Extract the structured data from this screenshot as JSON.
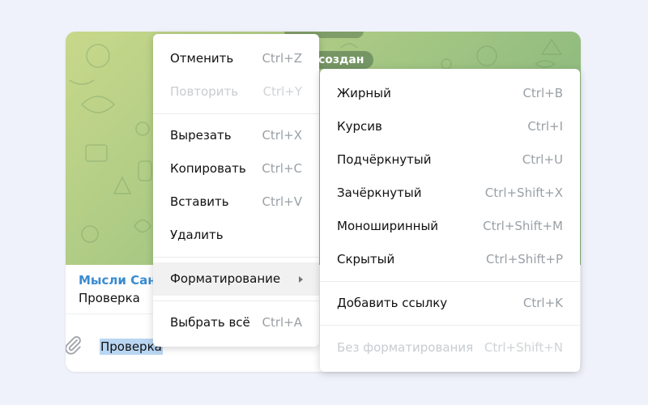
{
  "chat": {
    "date_pill": "создан",
    "reply": {
      "name": "Мысли Сан",
      "text": "Проверка"
    },
    "input": {
      "value": "Проверка"
    }
  },
  "context_menu": {
    "items": [
      {
        "label": "Отменить",
        "shortcut": "Ctrl+Z",
        "disabled": false
      },
      {
        "label": "Повторить",
        "shortcut": "Ctrl+Y",
        "disabled": true
      },
      {
        "label": "Вырезать",
        "shortcut": "Ctrl+X",
        "disabled": false
      },
      {
        "label": "Копировать",
        "shortcut": "Ctrl+C",
        "disabled": false
      },
      {
        "label": "Вставить",
        "shortcut": "Ctrl+V",
        "disabled": false
      },
      {
        "label": "Удалить",
        "shortcut": "",
        "disabled": false
      },
      {
        "label": "Форматирование",
        "shortcut": "",
        "disabled": false,
        "has_submenu": true,
        "active": true
      },
      {
        "label": "Выбрать всё",
        "shortcut": "Ctrl+A",
        "disabled": false
      }
    ]
  },
  "format_submenu": {
    "items": [
      {
        "label": "Жирный",
        "shortcut": "Ctrl+B",
        "disabled": false
      },
      {
        "label": "Курсив",
        "shortcut": "Ctrl+I",
        "disabled": false
      },
      {
        "label": "Подчёркнутый",
        "shortcut": "Ctrl+U",
        "disabled": false
      },
      {
        "label": "Зачёркнутый",
        "shortcut": "Ctrl+Shift+X",
        "disabled": false
      },
      {
        "label": "Моноширинный",
        "shortcut": "Ctrl+Shift+M",
        "disabled": false
      },
      {
        "label": "Скрытый",
        "shortcut": "Ctrl+Shift+P",
        "disabled": false
      },
      {
        "label": "Добавить ссылку",
        "shortcut": "Ctrl+K",
        "disabled": false
      },
      {
        "label": "Без форматирования",
        "shortcut": "Ctrl+Shift+N",
        "disabled": true
      }
    ]
  },
  "icons": {
    "attach": "paperclip-icon",
    "submenu_arrow": "chevron-right-icon"
  },
  "colors": {
    "page_background": "#f0f2fb",
    "reply_name": "#3a8bd0",
    "selection": "#b9d6f2",
    "chat_background": "#a9c984"
  }
}
